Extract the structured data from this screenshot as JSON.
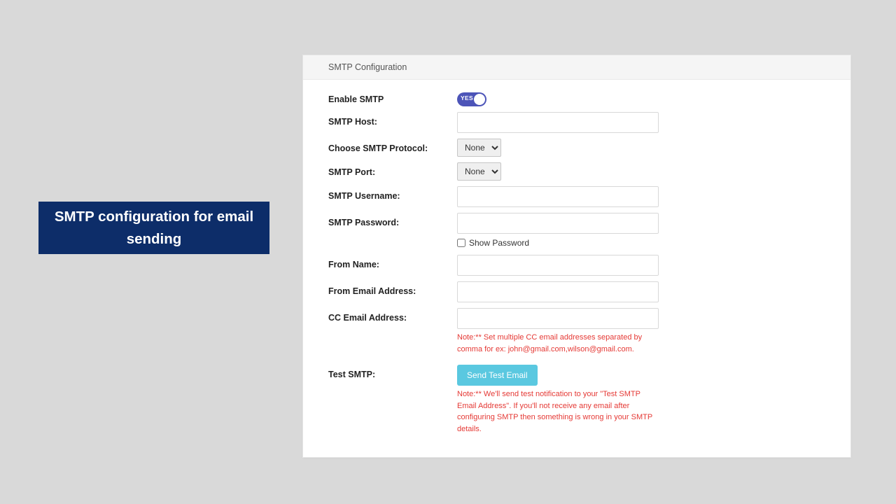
{
  "banner": {
    "title": "SMTP configuration for email sending"
  },
  "card": {
    "header": "SMTP Configuration"
  },
  "form": {
    "enable_smtp": {
      "label": "Enable SMTP",
      "value": true,
      "toggle_text": "YES"
    },
    "smtp_host": {
      "label": "SMTP Host:",
      "value": ""
    },
    "smtp_protocol": {
      "label": "Choose SMTP Protocol:",
      "selected": "None",
      "options": [
        "None"
      ]
    },
    "smtp_port": {
      "label": "SMTP Port:",
      "selected": "None",
      "options": [
        "None"
      ]
    },
    "smtp_username": {
      "label": "SMTP Username:",
      "value": ""
    },
    "smtp_password": {
      "label": "SMTP Password:",
      "value": "",
      "show_label": "Show Password",
      "show_checked": false
    },
    "from_name": {
      "label": "From Name:",
      "value": ""
    },
    "from_email": {
      "label": "From Email Address:",
      "value": ""
    },
    "cc_email": {
      "label": "CC Email Address:",
      "value": "",
      "note": "Note:** Set multiple CC email addresses separated by comma for ex: john@gmail.com,wilson@gmail.com."
    },
    "test_smtp": {
      "label": "Test SMTP:",
      "button": "Send Test Email",
      "note": "Note:** We'll send test notification to your \"Test SMTP Email Address\". If you'll not receive any email after configuring SMTP then something is wrong in your SMTP details."
    }
  }
}
